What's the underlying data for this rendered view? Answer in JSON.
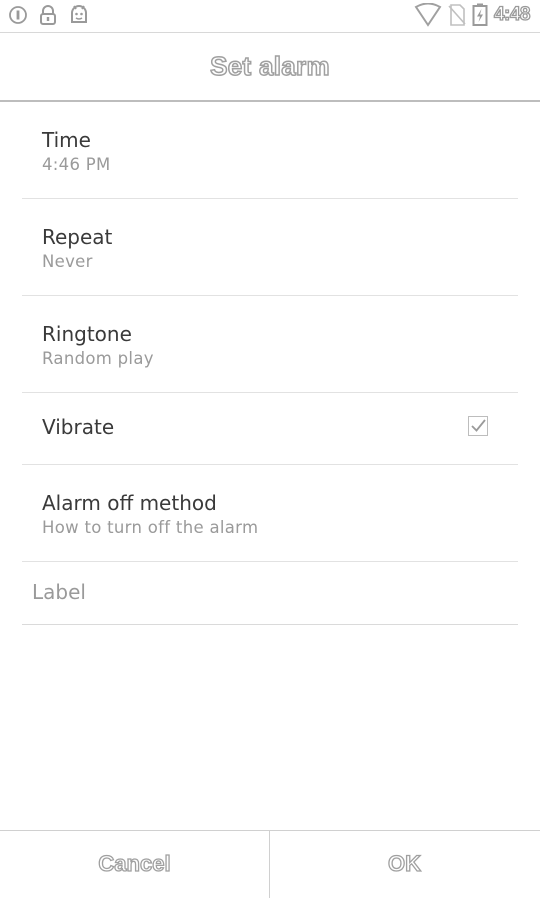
{
  "status_bar": {
    "time": "4:48",
    "left_icons": [
      "alarm-badge-icon",
      "lock-icon",
      "android-icon"
    ],
    "right_icons": [
      "wifi-icon",
      "no-sim-icon",
      "battery-charging-icon"
    ]
  },
  "header": {
    "title": "Set alarm"
  },
  "settings": {
    "items": [
      {
        "id": "time",
        "label": "Time",
        "value": "4:46 PM"
      },
      {
        "id": "repeat",
        "label": "Repeat",
        "value": "Never"
      },
      {
        "id": "ringtone",
        "label": "Ringtone",
        "value": "Random play"
      },
      {
        "id": "vibrate",
        "label": "Vibrate",
        "checked": true
      },
      {
        "id": "alarm_off",
        "label": "Alarm off method",
        "value": "How to turn off the alarm"
      }
    ]
  },
  "label_field": {
    "placeholder": "Label",
    "value": ""
  },
  "buttons": {
    "cancel": "Cancel",
    "ok": "OK"
  }
}
